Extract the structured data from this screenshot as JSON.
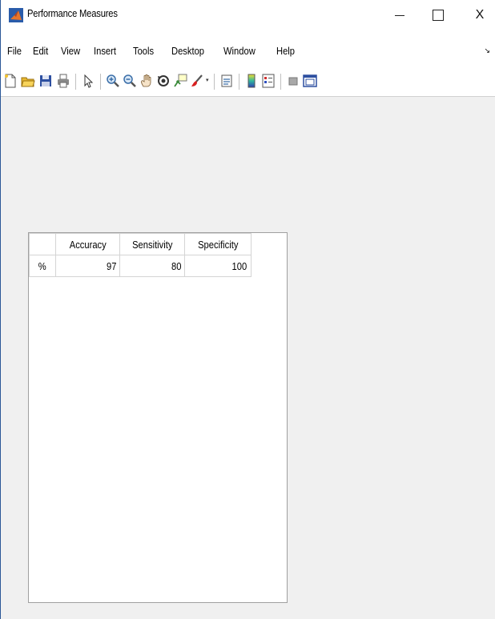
{
  "window": {
    "title": "Performance Measures",
    "controls": {
      "minimize": "–",
      "close": "X"
    }
  },
  "menubar": {
    "items": [
      {
        "id": "file",
        "label": "File"
      },
      {
        "id": "edit",
        "label": "Edit"
      },
      {
        "id": "view",
        "label": "View"
      },
      {
        "id": "insert",
        "label": "Insert"
      },
      {
        "id": "tools",
        "label": "Tools"
      },
      {
        "id": "desktop",
        "label": "Desktop"
      },
      {
        "id": "window",
        "label": "Window"
      },
      {
        "id": "help",
        "label": "Help"
      }
    ],
    "dock_arrow": "↘"
  },
  "toolbar": {
    "items": [
      "new-figure-icon",
      "open-file-icon",
      "save-icon",
      "print-icon",
      "pointer-icon",
      "zoom-in-icon",
      "zoom-out-icon",
      "pan-hand-icon",
      "rotate-3d-icon",
      "data-cursor-icon",
      "brush-icon",
      "link-plot-icon",
      "colorbar-icon",
      "legend-icon",
      "hide-plot-tools-icon",
      "show-plot-tools-icon"
    ],
    "dropdown_glyph": "▾"
  },
  "table": {
    "columns": [
      "Accuracy",
      "Sensitivity",
      "Specificity"
    ],
    "rows": [
      {
        "header": "%",
        "values": [
          "97",
          "80",
          "100"
        ]
      }
    ]
  },
  "colors": {
    "window_border": "#2b5797",
    "figure_background": "#f0f0f0",
    "matlab_orange": "#e8752a",
    "matlab_blue": "#2a5caa"
  }
}
